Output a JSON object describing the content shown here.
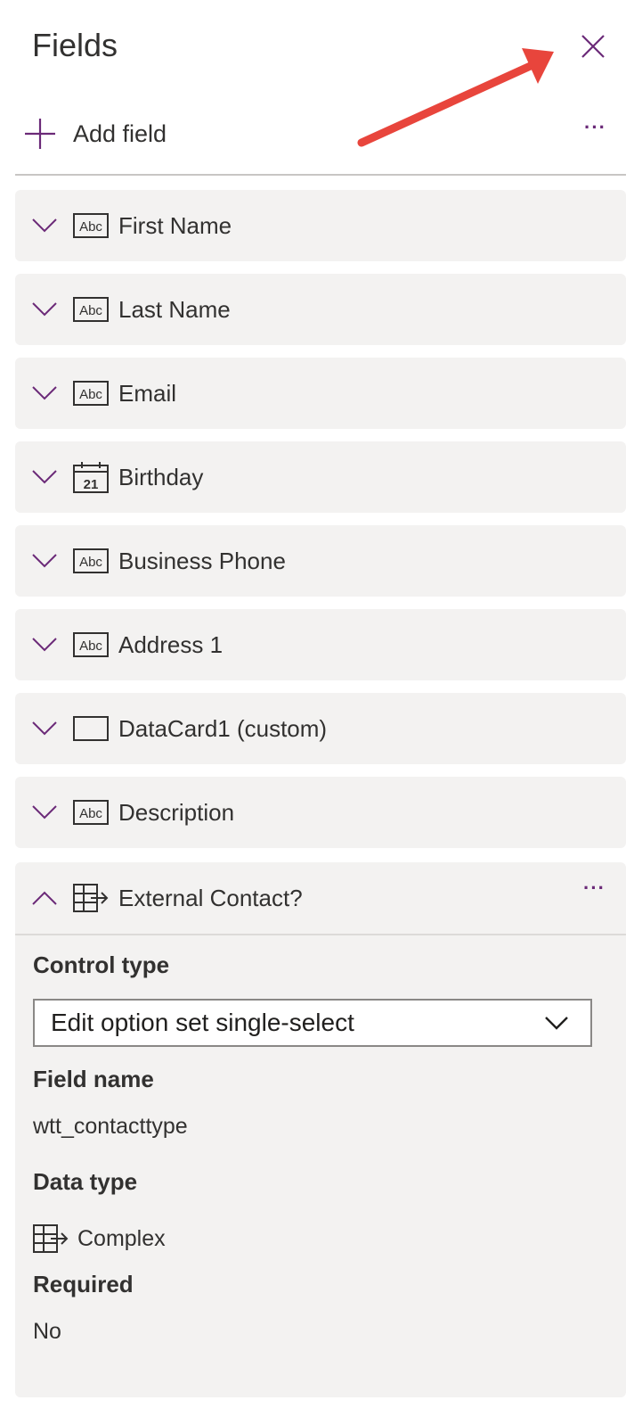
{
  "panel": {
    "title": "Fields",
    "add_field_label": "Add field",
    "more_label": "···"
  },
  "fields": [
    {
      "name": "First Name",
      "icon": "text-abc-icon"
    },
    {
      "name": "Last Name",
      "icon": "text-abc-icon"
    },
    {
      "name": "Email",
      "icon": "text-abc-icon"
    },
    {
      "name": "Birthday",
      "icon": "calendar-icon",
      "calendar_day": "21"
    },
    {
      "name": "Business Phone",
      "icon": "text-abc-icon"
    },
    {
      "name": "Address 1",
      "icon": "text-abc-icon"
    },
    {
      "name": "DataCard1 (custom)",
      "icon": "card-icon"
    },
    {
      "name": "Description",
      "icon": "text-abc-icon"
    }
  ],
  "abc_text": "Abc",
  "expanded_field": {
    "name": "External Contact?",
    "icon": "option-set-icon",
    "more_label": "···",
    "control_type_label": "Control type",
    "control_type_value": "Edit option set single-select",
    "field_name_label": "Field name",
    "field_name_value": "wtt_contacttype",
    "data_type_label": "Data type",
    "data_type_value": "Complex",
    "required_label": "Required",
    "required_value": "No"
  },
  "colors": {
    "accent": "#6b2a78",
    "annotation_arrow": "#e8453c",
    "card_bg": "#f3f2f1"
  }
}
